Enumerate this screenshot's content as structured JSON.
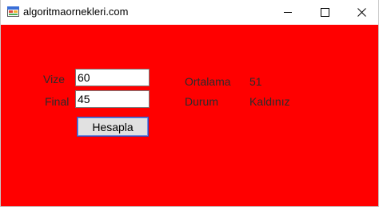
{
  "window": {
    "title": "algoritmaornekleri.com",
    "icon": "winforms-app-icon",
    "controls": {
      "minimize_icon": "minimize-icon",
      "maximize_icon": "maximize-icon",
      "close_icon": "close-icon"
    },
    "background_color": "#ff0000"
  },
  "form": {
    "vize_label": "Vize",
    "vize_value": "60",
    "final_label": "Final",
    "final_value": "45",
    "calculate_button": "Hesapla",
    "average_label": "Ortalama",
    "average_value": "51",
    "status_label": "Durum",
    "status_value": "Kaldınız"
  }
}
